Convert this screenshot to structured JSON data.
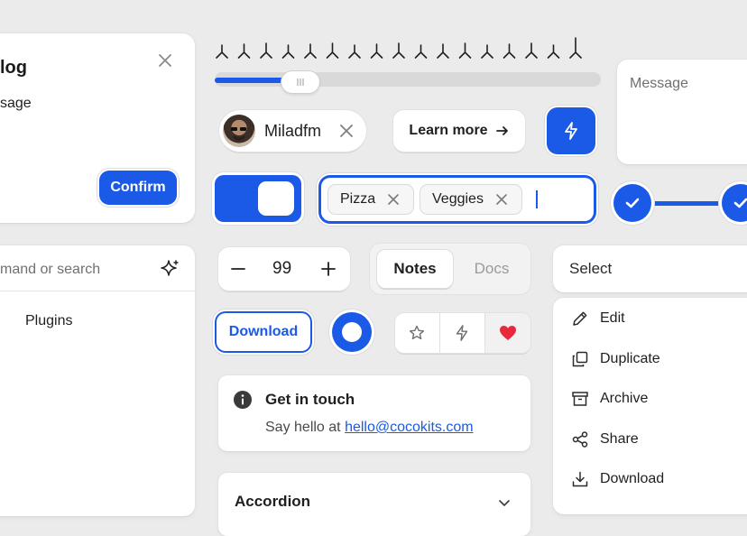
{
  "dialog": {
    "title": "log",
    "message": "sage",
    "confirm_label": "Confirm"
  },
  "rating": {
    "total": 17,
    "filled": 0,
    "value_fraction": 0.5
  },
  "slider": {
    "value_fraction": 0.32
  },
  "message_box": {
    "placeholder": "Message"
  },
  "user_chip": {
    "name": "Miladfm"
  },
  "learn_more": {
    "label": "Learn more"
  },
  "tags_input": {
    "tags": [
      "Pizza",
      "Veggies"
    ]
  },
  "command": {
    "placeholder": "mand or search",
    "item": "Plugins"
  },
  "stepper": {
    "value": "99"
  },
  "tabs": {
    "items": [
      "Notes",
      "Docs"
    ],
    "selected": "Notes"
  },
  "select": {
    "label": "Select"
  },
  "download_button": {
    "label": "Download"
  },
  "dropdown_menu": {
    "items": [
      {
        "label": "Edit",
        "icon": "pencil-icon"
      },
      {
        "label": "Duplicate",
        "icon": "duplicate-icon"
      },
      {
        "label": "Archive",
        "icon": "archive-icon"
      },
      {
        "label": "Share",
        "icon": "share-icon"
      },
      {
        "label": "Download",
        "icon": "download-icon"
      }
    ]
  },
  "alert": {
    "title": "Get in touch",
    "text": "Say hello at ",
    "link": "hello@cocokits.com"
  },
  "accordion": {
    "title": "Accordion"
  },
  "colors": {
    "accent": "#1a5ae6",
    "heart": "#e8283c"
  }
}
